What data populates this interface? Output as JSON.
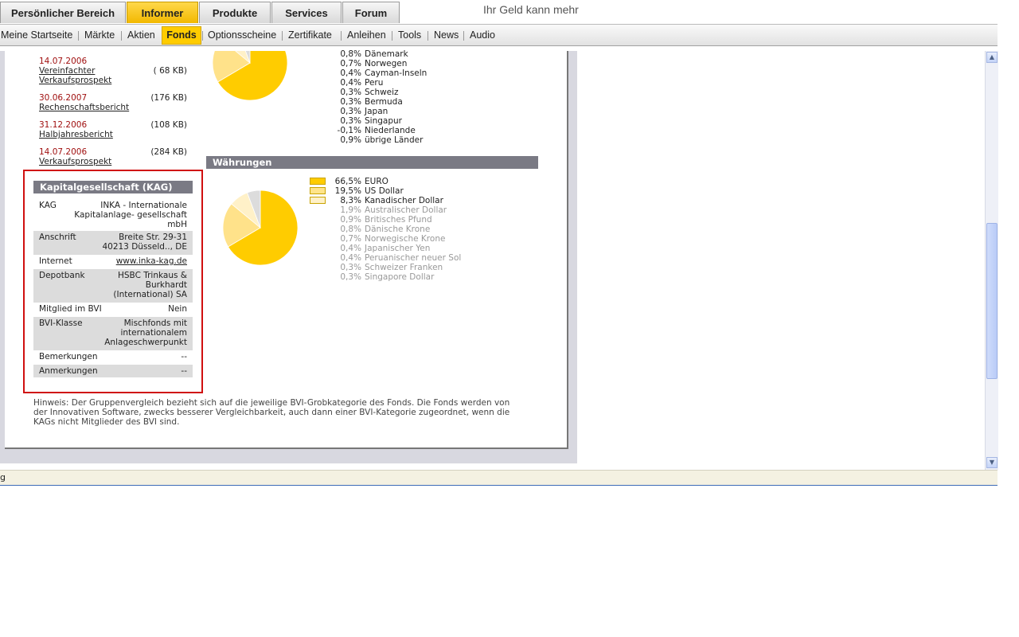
{
  "tagline": "Ihr Geld kann mehr",
  "top_tabs": [
    "Persönlicher Bereich",
    "Informer",
    "Produkte",
    "Services",
    "Forum"
  ],
  "active_top_tab": "Informer",
  "sub_nav": [
    "Meine Startseite",
    "Märkte",
    "Aktien",
    "Fonds",
    "Optionsscheine",
    "Zertifikate",
    "Anleihen",
    "Tools",
    "News",
    "Audio"
  ],
  "active_sub_nav": "Fonds",
  "documents": [
    {
      "date": "14.07.2006",
      "title_line1": "Vereinfachter",
      "title_line2": "Verkaufsprospekt",
      "size": "( 68 KB)"
    },
    {
      "date": "30.06.2007",
      "title_line1": "Rechenschaftsbericht",
      "title_line2": "",
      "size": "(176 KB)"
    },
    {
      "date": "31.12.2006",
      "title_line1": "Halbjahresbericht",
      "title_line2": "",
      "size": "(108 KB)"
    },
    {
      "date": "14.07.2006",
      "title_line1": "Verkaufsprospekt",
      "title_line2": "",
      "size": "(284 KB)"
    }
  ],
  "countries": [
    {
      "pct": "0,8%",
      "name": "Dänemark"
    },
    {
      "pct": "0,7%",
      "name": "Norwegen"
    },
    {
      "pct": "0,4%",
      "name": "Cayman-Inseln"
    },
    {
      "pct": "0,4%",
      "name": "Peru"
    },
    {
      "pct": "0,3%",
      "name": "Schweiz"
    },
    {
      "pct": "0,3%",
      "name": "Bermuda"
    },
    {
      "pct": "0,3%",
      "name": "Japan"
    },
    {
      "pct": "0,3%",
      "name": "Singapur"
    },
    {
      "pct": "-0,1%",
      "name": "Niederlande"
    },
    {
      "pct": "0,9%",
      "name": "übrige Länder"
    }
  ],
  "kag": {
    "heading": "Kapitalgesellschaft (KAG)",
    "rows": [
      {
        "key": "KAG",
        "value_lines": [
          "INKA - Internationale",
          "Kapitalanlage- gesellschaft",
          "mbH"
        ]
      },
      {
        "key": "Anschrift",
        "value_lines": [
          "Breite Str. 29-31",
          "40213 Düsseld.., DE"
        ]
      },
      {
        "key": "Internet",
        "value_lines": [
          "www.inka-kag.de"
        ]
      },
      {
        "key": "Depotbank",
        "value_lines": [
          "HSBC Trinkaus &",
          "Burkhardt",
          "(International) SA"
        ]
      },
      {
        "key": "Mitglied im BVI",
        "value_lines": [
          "Nein"
        ]
      },
      {
        "key": "BVI-Klasse",
        "value_lines": [
          "Mischfonds mit",
          "internationalem",
          "Anlageschwerpunkt"
        ]
      },
      {
        "key": "Bemerkungen",
        "value_lines": [
          "--"
        ]
      },
      {
        "key": "Anmerkungen",
        "value_lines": [
          "--"
        ]
      }
    ]
  },
  "currencies": {
    "heading": "Währungen",
    "items": [
      {
        "pct": "66,5%",
        "name": "EURO"
      },
      {
        "pct": "19,5%",
        "name": "US Dollar"
      },
      {
        "pct": "8,3%",
        "name": "Kanadischer Dollar"
      },
      {
        "pct": "1,9%",
        "name": "Australischer Dollar"
      },
      {
        "pct": "0,9%",
        "name": "Britisches Pfund"
      },
      {
        "pct": "0,8%",
        "name": "Dänische Krone"
      },
      {
        "pct": "0,7%",
        "name": "Norwegische Krone"
      },
      {
        "pct": "0,4%",
        "name": "Japanischer Yen"
      },
      {
        "pct": "0,4%",
        "name": "Peruanischer neuer Sol"
      },
      {
        "pct": "0,3%",
        "name": "Schweizer Franken"
      },
      {
        "pct": "0,3%",
        "name": "Singapore Dollar"
      }
    ]
  },
  "hint_lines": [
    "Hinweis: Der Gruppenvergleich bezieht sich auf die jeweilige BVI-Grobkategorie des Fonds. Die Fonds werden von",
    "der Innovativen Software, zwecks besserer Vergleichbarkeit, auch dann einer BVI-Kategorie zugeordnet, wenn die",
    "KAGs nicht Mitglieder des BVI sind."
  ],
  "status_text": "g",
  "colors": {
    "accent": "#ffcc00",
    "highlight_border": "#d01010",
    "section_header": "#7a7a84"
  },
  "chart_data": [
    {
      "type": "pie",
      "values": [
        66.5,
        19.5,
        8.3,
        5.7
      ],
      "categories": [
        "",
        "",
        "",
        ""
      ]
    },
    {
      "type": "pie",
      "categories": [
        "EURO",
        "US Dollar",
        "Kanadischer Dollar",
        "Rest"
      ],
      "values": [
        66.5,
        19.5,
        8.3,
        5.7
      ]
    }
  ]
}
